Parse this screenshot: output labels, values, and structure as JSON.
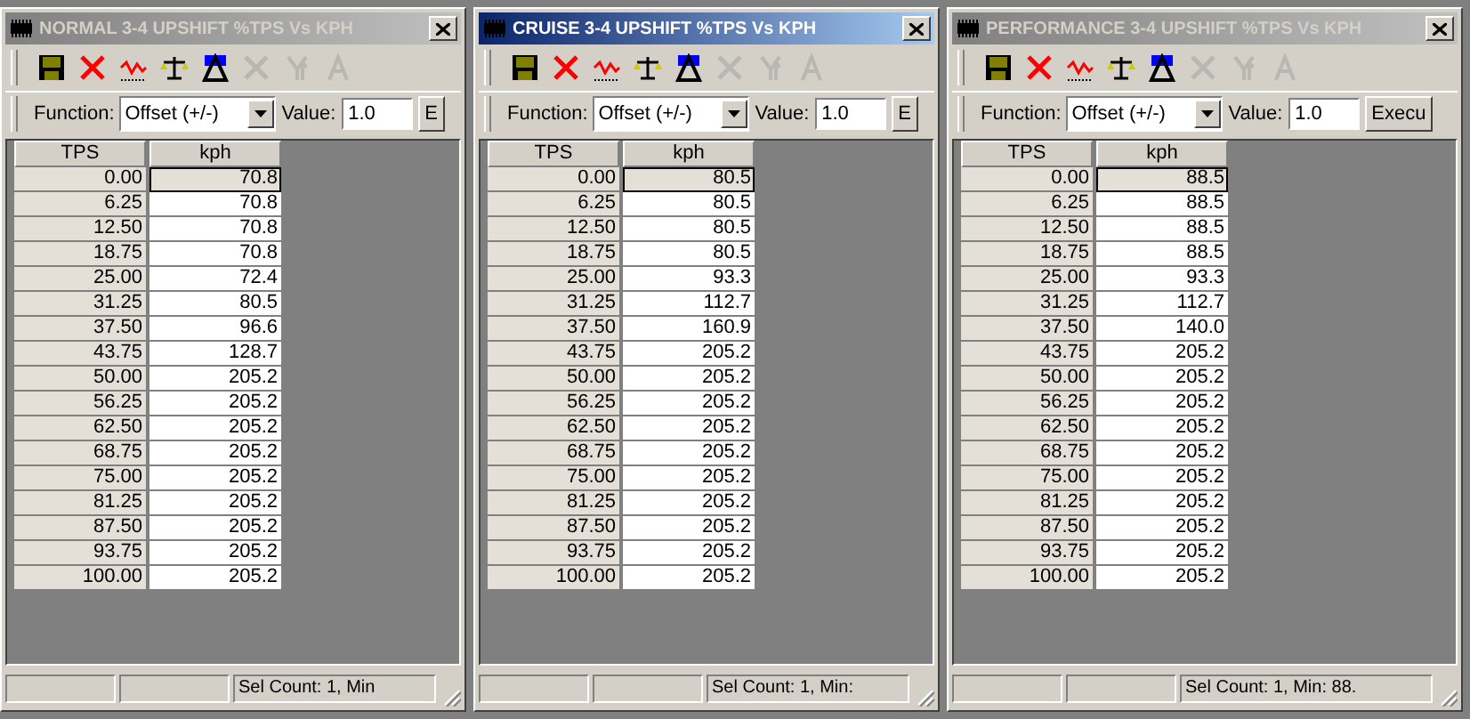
{
  "windows": [
    {
      "title": "NORMAL 3-4 UPSHIFT %TPS Vs KPH",
      "active": false,
      "toolbar": [
        {
          "kind": "save",
          "disabled": false
        },
        {
          "kind": "delete",
          "disabled": false
        },
        {
          "kind": "graph",
          "disabled": false
        },
        {
          "kind": "scale",
          "disabled": false
        },
        {
          "kind": "delta",
          "disabled": false
        },
        {
          "kind": "x",
          "disabled": true
        },
        {
          "kind": "y",
          "disabled": true
        },
        {
          "kind": "a",
          "disabled": true
        }
      ],
      "function_label": "Function:",
      "function_value": "Offset (+/-)",
      "value_label": "Value:",
      "value": "1.0",
      "execute_label": "E",
      "columns": [
        "TPS",
        "kph"
      ],
      "rows": [
        {
          "tps": "0.00",
          "kph": "70.8",
          "selected": true
        },
        {
          "tps": "6.25",
          "kph": "70.8",
          "selected": false
        },
        {
          "tps": "12.50",
          "kph": "70.8",
          "selected": false
        },
        {
          "tps": "18.75",
          "kph": "70.8",
          "selected": false
        },
        {
          "tps": "25.00",
          "kph": "72.4",
          "selected": false
        },
        {
          "tps": "31.25",
          "kph": "80.5",
          "selected": false
        },
        {
          "tps": "37.50",
          "kph": "96.6",
          "selected": false
        },
        {
          "tps": "43.75",
          "kph": "128.7",
          "selected": false
        },
        {
          "tps": "50.00",
          "kph": "205.2",
          "selected": false
        },
        {
          "tps": "56.25",
          "kph": "205.2",
          "selected": false
        },
        {
          "tps": "62.50",
          "kph": "205.2",
          "selected": false
        },
        {
          "tps": "68.75",
          "kph": "205.2",
          "selected": false
        },
        {
          "tps": "75.00",
          "kph": "205.2",
          "selected": false
        },
        {
          "tps": "81.25",
          "kph": "205.2",
          "selected": false
        },
        {
          "tps": "87.50",
          "kph": "205.2",
          "selected": false
        },
        {
          "tps": "93.75",
          "kph": "205.2",
          "selected": false
        },
        {
          "tps": "100.00",
          "kph": "205.2",
          "selected": false
        }
      ],
      "status": "Sel Count: 1, Min"
    },
    {
      "title": "CRUISE 3-4 UPSHIFT %TPS Vs KPH",
      "active": true,
      "toolbar": [
        {
          "kind": "save",
          "disabled": false
        },
        {
          "kind": "delete",
          "disabled": false
        },
        {
          "kind": "graph",
          "disabled": false
        },
        {
          "kind": "scale",
          "disabled": false
        },
        {
          "kind": "delta",
          "disabled": false
        },
        {
          "kind": "x",
          "disabled": true
        },
        {
          "kind": "y",
          "disabled": true
        },
        {
          "kind": "a",
          "disabled": true
        }
      ],
      "function_label": "Function:",
      "function_value": "Offset (+/-)",
      "value_label": "Value:",
      "value": "1.0",
      "execute_label": "E",
      "columns": [
        "TPS",
        "kph"
      ],
      "rows": [
        {
          "tps": "0.00",
          "kph": "80.5",
          "selected": true
        },
        {
          "tps": "6.25",
          "kph": "80.5",
          "selected": false
        },
        {
          "tps": "12.50",
          "kph": "80.5",
          "selected": false
        },
        {
          "tps": "18.75",
          "kph": "80.5",
          "selected": false
        },
        {
          "tps": "25.00",
          "kph": "93.3",
          "selected": false
        },
        {
          "tps": "31.25",
          "kph": "112.7",
          "selected": false
        },
        {
          "tps": "37.50",
          "kph": "160.9",
          "selected": false
        },
        {
          "tps": "43.75",
          "kph": "205.2",
          "selected": false
        },
        {
          "tps": "50.00",
          "kph": "205.2",
          "selected": false
        },
        {
          "tps": "56.25",
          "kph": "205.2",
          "selected": false
        },
        {
          "tps": "62.50",
          "kph": "205.2",
          "selected": false
        },
        {
          "tps": "68.75",
          "kph": "205.2",
          "selected": false
        },
        {
          "tps": "75.00",
          "kph": "205.2",
          "selected": false
        },
        {
          "tps": "81.25",
          "kph": "205.2",
          "selected": false
        },
        {
          "tps": "87.50",
          "kph": "205.2",
          "selected": false
        },
        {
          "tps": "93.75",
          "kph": "205.2",
          "selected": false
        },
        {
          "tps": "100.00",
          "kph": "205.2",
          "selected": false
        }
      ],
      "status": "Sel Count: 1, Min:"
    },
    {
      "title": "PERFORMANCE 3-4 UPSHIFT %TPS Vs KPH",
      "active": false,
      "toolbar": [
        {
          "kind": "save",
          "disabled": false
        },
        {
          "kind": "delete",
          "disabled": false
        },
        {
          "kind": "graph",
          "disabled": false
        },
        {
          "kind": "scale",
          "disabled": false
        },
        {
          "kind": "delta",
          "disabled": false
        },
        {
          "kind": "x",
          "disabled": true
        },
        {
          "kind": "y",
          "disabled": true
        },
        {
          "kind": "a",
          "disabled": true
        }
      ],
      "function_label": "Function:",
      "function_value": "Offset (+/-)",
      "value_label": "Value:",
      "value": "1.0",
      "execute_label": "Execu",
      "columns": [
        "TPS",
        "kph"
      ],
      "rows": [
        {
          "tps": "0.00",
          "kph": "88.5",
          "selected": true
        },
        {
          "tps": "6.25",
          "kph": "88.5",
          "selected": false
        },
        {
          "tps": "12.50",
          "kph": "88.5",
          "selected": false
        },
        {
          "tps": "18.75",
          "kph": "88.5",
          "selected": false
        },
        {
          "tps": "25.00",
          "kph": "93.3",
          "selected": false
        },
        {
          "tps": "31.25",
          "kph": "112.7",
          "selected": false
        },
        {
          "tps": "37.50",
          "kph": "140.0",
          "selected": false
        },
        {
          "tps": "43.75",
          "kph": "205.2",
          "selected": false
        },
        {
          "tps": "50.00",
          "kph": "205.2",
          "selected": false
        },
        {
          "tps": "56.25",
          "kph": "205.2",
          "selected": false
        },
        {
          "tps": "62.50",
          "kph": "205.2",
          "selected": false
        },
        {
          "tps": "68.75",
          "kph": "205.2",
          "selected": false
        },
        {
          "tps": "75.00",
          "kph": "205.2",
          "selected": false
        },
        {
          "tps": "81.25",
          "kph": "205.2",
          "selected": false
        },
        {
          "tps": "87.50",
          "kph": "205.2",
          "selected": false
        },
        {
          "tps": "93.75",
          "kph": "205.2",
          "selected": false
        },
        {
          "tps": "100.00",
          "kph": "205.2",
          "selected": false
        }
      ],
      "status": "Sel Count: 1, Min: 88."
    }
  ]
}
